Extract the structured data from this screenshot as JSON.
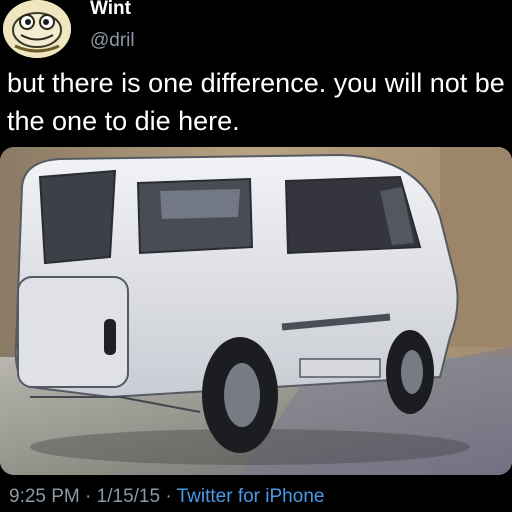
{
  "tweet": {
    "display_name": "Wint",
    "handle": "@dril",
    "text": "but there is one difference. you will not be the one to die here.",
    "time": "9:25 PM",
    "date": "1/15/15",
    "separator": " · ",
    "source": "Twitter for iPhone",
    "avatar_icon": "frog-avatar-icon",
    "media_icon": "van-photo"
  },
  "colors": {
    "background": "#000000",
    "primary_text": "#ffffff",
    "secondary_text": "#8b98a5",
    "link": "#4a99e9"
  }
}
